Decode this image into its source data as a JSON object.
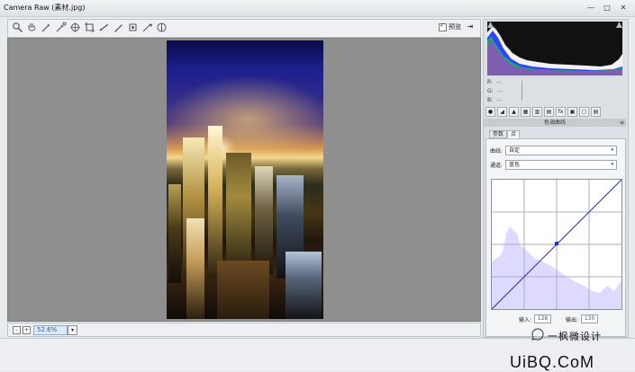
{
  "window": {
    "title": "Camera Raw (素材.jpg)",
    "minimize": "—",
    "maximize": "□",
    "close": "✕"
  },
  "toolbar": {
    "tools": [
      "zoom-icon",
      "hand-icon",
      "white-balance-icon",
      "color-sampler-icon",
      "targeted-adjustment-icon",
      "crop-icon",
      "straighten-icon",
      "spot-removal-icon",
      "red-eye-icon",
      "adjustment-brush-icon",
      "graduated-filter-icon"
    ],
    "preview_label": "预览",
    "preview_checked": true,
    "export_icon": "⇥"
  },
  "zoom": {
    "minus": "-",
    "plus": "+",
    "value": "52.6%",
    "arrow": "▾"
  },
  "readout": [
    {
      "channel": "R:",
      "value": "---"
    },
    {
      "channel": "G:",
      "value": "---"
    },
    {
      "channel": "B:",
      "value": "---"
    }
  ],
  "panel": {
    "section_title": "色调曲线",
    "menu_icon": "≡",
    "tab_icons": [
      "●",
      "◢",
      "▲",
      "▦",
      "▥",
      "▤",
      "fx",
      "▣",
      "▢",
      "▤"
    ],
    "subtabs": [
      "参数",
      "点"
    ],
    "curve_label": "曲线:",
    "curve_value": "自定",
    "channel_label": "通道:",
    "channel_value": "蓝色",
    "dropdown_arrow": "▾",
    "input_label": "输入:",
    "input_value": "128",
    "output_label": "输出:",
    "output_value": "130"
  },
  "watermark": {
    "text": "一枫微设计",
    "brand": "UiBQ.CoM"
  },
  "colors": {
    "accent": "#1d2ecb",
    "histogram_fill": "#dcd7ff",
    "curve": "#1f2fd2"
  }
}
